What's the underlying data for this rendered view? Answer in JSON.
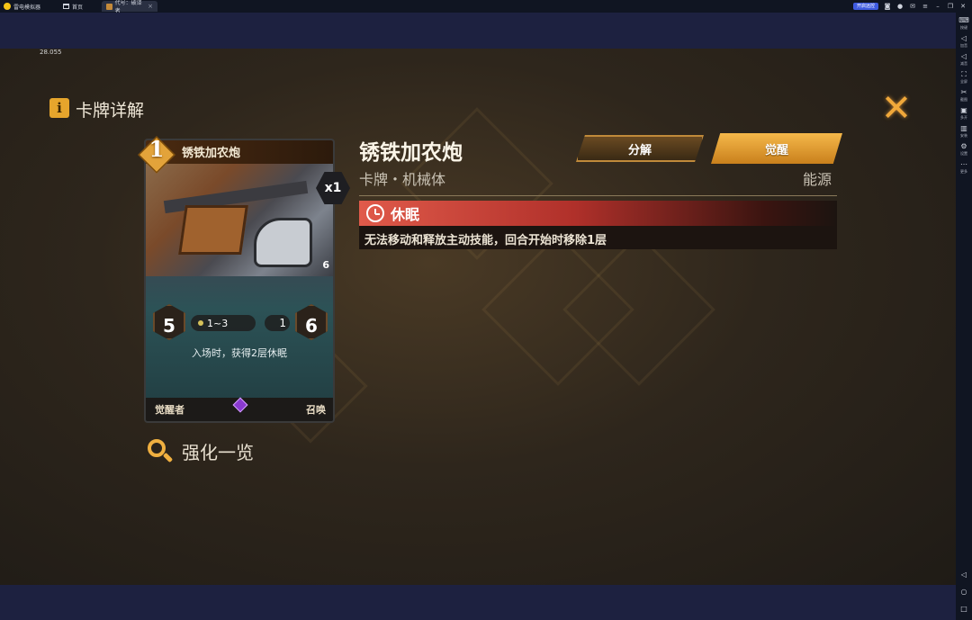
{
  "titlebar": {
    "app_name": "雷电模拟器",
    "tabs": [
      {
        "label": "首页"
      },
      {
        "label": "代号：破译者"
      }
    ],
    "remote_button": "开启远控"
  },
  "sidebar": {
    "items": [
      {
        "icon": "keyboard-icon",
        "label": "按键"
      },
      {
        "icon": "volume-up-icon",
        "label": "加音"
      },
      {
        "icon": "volume-down-icon",
        "label": "减音"
      },
      {
        "icon": "fullscreen-icon",
        "label": "全屏"
      },
      {
        "icon": "scissors-icon",
        "label": "截图"
      },
      {
        "icon": "multi-window-icon",
        "label": "多开"
      },
      {
        "icon": "install-icon",
        "label": "安装"
      },
      {
        "icon": "settings-icon",
        "label": "设置"
      },
      {
        "icon": "more-icon",
        "label": "更多"
      }
    ]
  },
  "game": {
    "fps": "28.055",
    "header_title": "卡牌详解",
    "card": {
      "cost": "1",
      "name": "锈铁加农炮",
      "quantity": "x1",
      "attack": "5",
      "range": "1~3",
      "small_value": "1",
      "health": "6",
      "corner_value": "6",
      "text": "入场时，获得2层休眠",
      "type": "觉醒者",
      "kind": "召唤"
    },
    "detail": {
      "title": "锈铁加农炮",
      "subtitle": "卡牌・机械体",
      "energy_label": "能源",
      "decompose_button": "分解",
      "awaken_button": "觉醒",
      "status_name": "休眠",
      "status_desc": "无法移动和释放主动技能，回合开始时移除1层"
    },
    "enhance_label": "强化一览"
  }
}
